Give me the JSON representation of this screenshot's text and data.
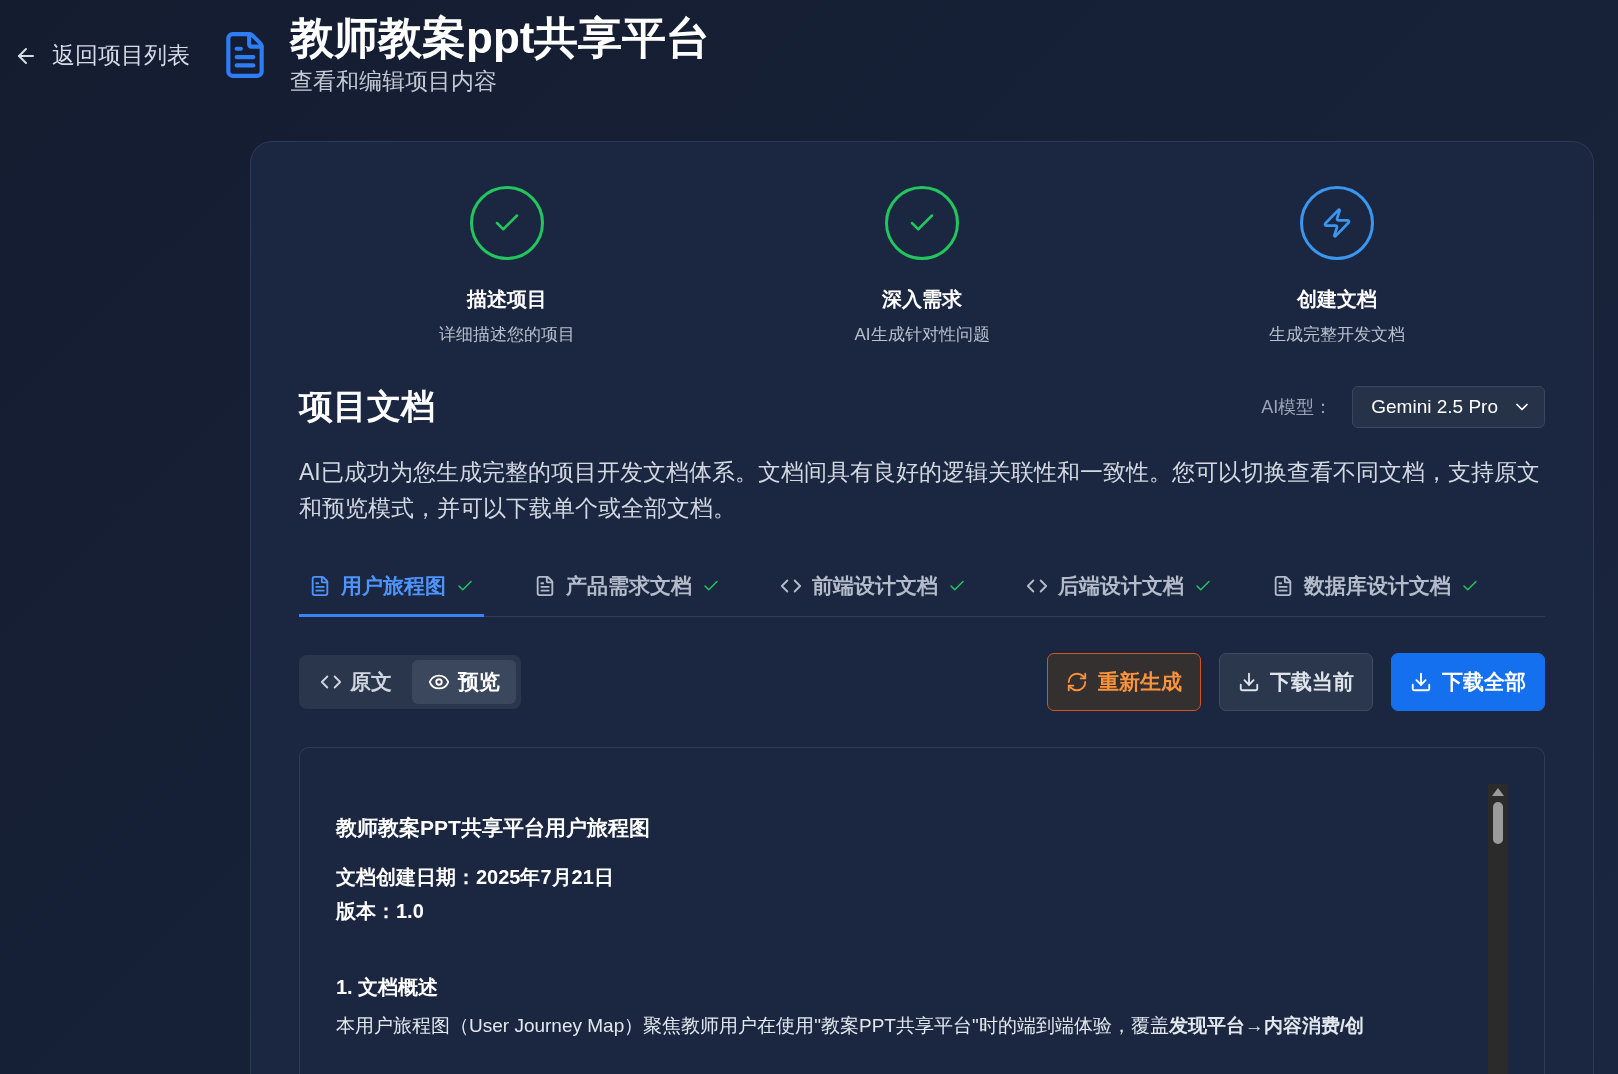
{
  "back_link": "返回项目列表",
  "header": {
    "title": "教师教案ppt共享平台",
    "subtitle": "查看和编辑项目内容"
  },
  "steps": [
    {
      "kind": "done",
      "title": "描述项目",
      "caption": "详细描述您的项目"
    },
    {
      "kind": "done",
      "title": "深入需求",
      "caption": "AI生成针对性问题"
    },
    {
      "kind": "current",
      "title": "创建文档",
      "caption": "生成完整开发文档"
    }
  ],
  "documents": {
    "title": "项目文档",
    "model_label": "AI模型：",
    "model": "Gemini 2.5 Pro",
    "description": "AI已成功为您生成完整的项目开发文档体系。文档间具有良好的逻辑关联性和一致性。您可以切换查看不同文档，支持原文和预览模式，并可以下载单个或全部文档。",
    "tabs": [
      {
        "label": "用户旅程图",
        "kind": "document",
        "selected": true,
        "done": true
      },
      {
        "label": "产品需求文档",
        "kind": "document",
        "selected": false,
        "done": true
      },
      {
        "label": "前端设计文档",
        "kind": "code",
        "selected": false,
        "done": true
      },
      {
        "label": "后端设计文档",
        "kind": "code",
        "selected": false,
        "done": true
      },
      {
        "label": "数据库设计文档",
        "kind": "document",
        "selected": false,
        "done": true
      }
    ],
    "view_modes": [
      {
        "label": "原文",
        "kind": "source",
        "selected": false
      },
      {
        "label": "预览",
        "kind": "preview",
        "selected": true
      }
    ],
    "actions": [
      {
        "kind": "regenerate",
        "label": "重新生成"
      },
      {
        "kind": "secondary",
        "label": "下载当前"
      },
      {
        "kind": "primary",
        "label": "下载全部"
      }
    ],
    "preview": {
      "title": "教师教案PPT共享平台用户旅程图",
      "meta": [
        "文档创建日期：2025年7月21日",
        "版本：1.0"
      ],
      "section": "1. 文档概述",
      "paragraph": "本用户旅程图（User Journey Map）聚焦教师用户在使用\"教案PPT共享平台\"时的端到端体验，覆盖**发现平台→内容消费/创**"
    }
  }
}
